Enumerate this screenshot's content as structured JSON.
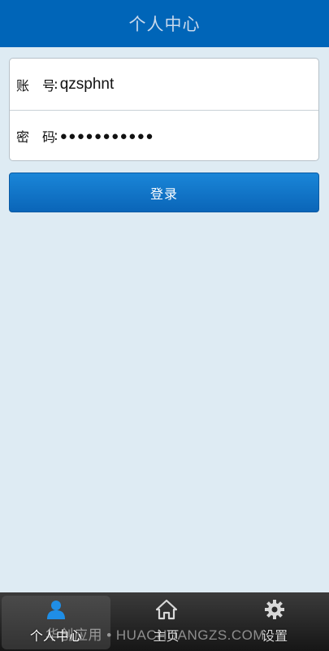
{
  "header": {
    "title": "个人中心"
  },
  "form": {
    "account": {
      "label": "账　号",
      "colon": ":",
      "value": "qzsphnt"
    },
    "password": {
      "label": "密　码",
      "colon": ":",
      "value": "●●●●●●●●●●●"
    }
  },
  "login_button": "登录",
  "tabbar": {
    "tabs": [
      {
        "label": "个人中心",
        "icon": "user-icon",
        "active": true
      },
      {
        "label": "主页",
        "icon": "home-icon",
        "active": false
      },
      {
        "label": "设置",
        "icon": "gear-icon",
        "active": false
      }
    ]
  },
  "watermark": "华创应用 • HUACHUANGZS.COM",
  "colors": {
    "header": "#0065b8",
    "background": "#deebf3",
    "button": "#0a6ec4",
    "accent_icon": "#1f8ee6"
  }
}
